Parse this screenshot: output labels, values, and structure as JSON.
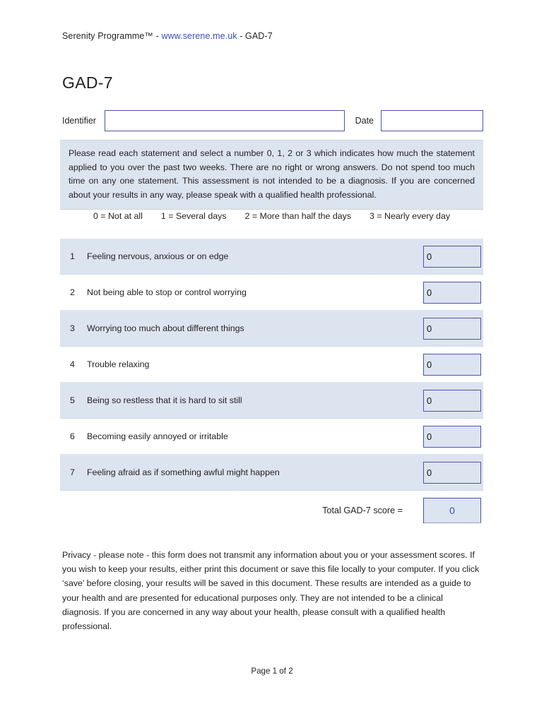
{
  "header": {
    "brand": "Serenity Programme™ - ",
    "url": "www.serene.me.uk",
    "suffix": " - GAD-7"
  },
  "title": "GAD-7",
  "form": {
    "identifier_label": "Identifier",
    "identifier_value": "",
    "identifier_placeholder": "",
    "date_label": "Date",
    "date_value": "",
    "date_placeholder": ""
  },
  "instructions": "Please read each statement and select a number 0, 1, 2 or 3 which indicates how much the statement applied to you over the past two weeks. There are no right or wrong answers. Do not spend too much time on any one statement. This assessment is not intended to be a diagnosis. If you are concerned about your results in any way, please speak with a qualified health professional.",
  "scale": [
    "0  =  Not at all",
    "1  =  Several days",
    "2  =  More than half the days",
    "3  =  Nearly every day"
  ],
  "questions": [
    {
      "num": "1",
      "text": "Feeling nervous, anxious or on edge",
      "value": "0"
    },
    {
      "num": "2",
      "text": "Not being able to stop or control worrying",
      "value": "0"
    },
    {
      "num": "3",
      "text": "Worrying too much about different things",
      "value": "0"
    },
    {
      "num": "4",
      "text": "Trouble relaxing",
      "value": "0"
    },
    {
      "num": "5",
      "text": "Being so restless that it is hard to sit still",
      "value": "0"
    },
    {
      "num": "6",
      "text": "Becoming easily annoyed or irritable",
      "value": "0"
    },
    {
      "num": "7",
      "text": "Feeling afraid as if something awful might happen",
      "value": "0"
    }
  ],
  "total": {
    "label": "Total GAD-7 score =",
    "value": "0"
  },
  "privacy": "Privacy - please note - this form does not transmit any information about you or your assessment scores. If you wish to keep your results, either print this document or save this file locally to your computer. If you click ‘save’ before closing, your results will be saved in this document. These results are intended as a guide to your health and are presented for educational purposes only. They are not intended to be a clinical diagnosis. If you are concerned in any way about your health, please consult with a qualified health professional.",
  "footer": "Page 1 of 2",
  "colors": {
    "accent_blue": "#3b4cc0",
    "border_blue": "#4a55ab",
    "row_shade": "#dce4f0",
    "text": "#231f20"
  }
}
